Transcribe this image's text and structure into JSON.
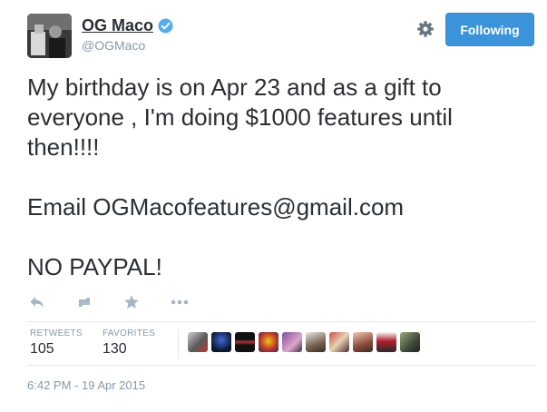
{
  "user": {
    "display_name": "OG Maco",
    "handle": "@OGMaco",
    "verified": true
  },
  "header": {
    "follow_button_label": "Following",
    "settings_icon": "gear-icon"
  },
  "tweet": {
    "lines": [
      "My birthday is on Apr 23 and as a gift to",
      "everyone , I'm doing $1000 features until",
      "then!!!!",
      "",
      "Email OGMacofeatures@gmail.com",
      "",
      "NO PAYPAL!"
    ]
  },
  "actions": {
    "icons": [
      "reply-icon",
      "retweet-icon",
      "favorite-icon",
      "more-icon"
    ]
  },
  "stats": {
    "retweets_label": "RETWEETS",
    "retweets_count": "105",
    "favorites_label": "FAVORITES",
    "favorites_count": "130"
  },
  "favoriters": {
    "count_shown": 10
  },
  "timestamp": "6:42 PM - 19 Apr 2015",
  "colors": {
    "accent": "#3b94d9",
    "muted": "#8899a6",
    "text": "#292f33",
    "divider": "#e1e8ed"
  }
}
